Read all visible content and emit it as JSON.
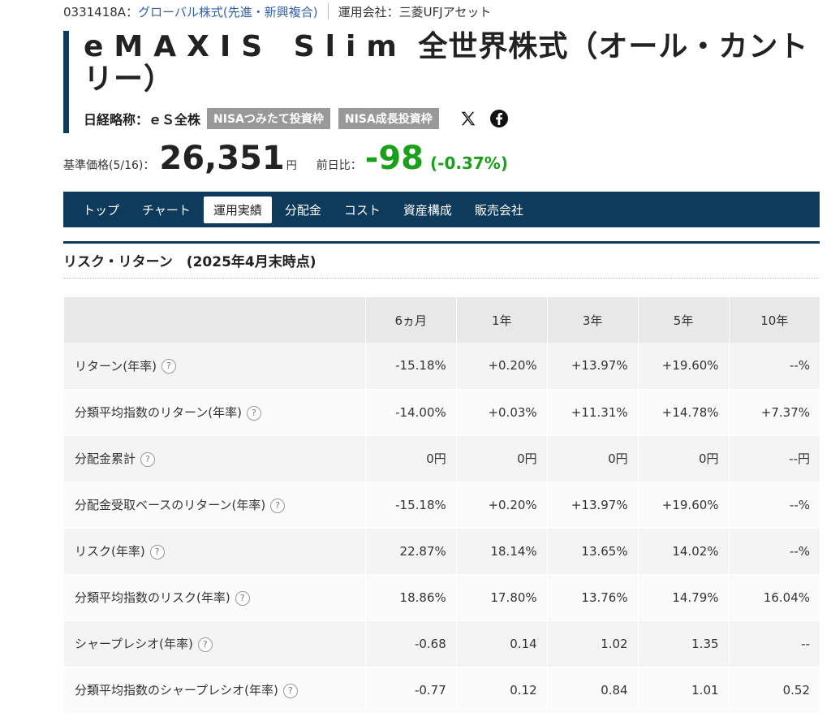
{
  "meta": {
    "fund_code": "0331418A：",
    "category": "グローバル株式(先進・新興複合)",
    "company": "運用会社：三菱UFJアセット"
  },
  "title": {
    "latin": "eMAXIS Slim",
    "rest": " 全世界株式（オール・カントリー）"
  },
  "nickname": {
    "label": "日経略称：ｅＳ全株",
    "badges": [
      "NISAつみたて投資枠",
      "NISA成長投資枠"
    ]
  },
  "social": [
    "x-icon",
    "facebook-icon"
  ],
  "price": {
    "label": "基準価格(5/16)：",
    "value": "26,351",
    "unit": "円",
    "diff_label": "前日比：",
    "diff_value": "-98",
    "diff_pct": "(-0.37%)",
    "diff_color": "#1aa01a"
  },
  "tabs": [
    "トップ",
    "チャート",
    "運用実績",
    "分配金",
    "コスト",
    "資産構成",
    "販売会社"
  ],
  "active_tab": "運用実績",
  "section": {
    "title": "リスク・リターン　(2025年4月末時点)"
  },
  "table": {
    "headers": [
      "6ヵ月",
      "1年",
      "3年",
      "5年",
      "10年"
    ],
    "rows": [
      {
        "label": "リターン(年率)",
        "values": [
          "-15.18%",
          "+0.20%",
          "+13.97%",
          "+19.60%",
          "--%"
        ]
      },
      {
        "label": "分類平均指数のリターン(年率)",
        "values": [
          "-14.00%",
          "+0.03%",
          "+11.31%",
          "+14.78%",
          "+7.37%"
        ]
      },
      {
        "label": "分配金累計",
        "values": [
          "0円",
          "0円",
          "0円",
          "0円",
          "--円"
        ]
      },
      {
        "label": "分配金受取ベースのリターン(年率)",
        "values": [
          "-15.18%",
          "+0.20%",
          "+13.97%",
          "+19.60%",
          "--%"
        ]
      },
      {
        "label": "リスク(年率)",
        "values": [
          "22.87%",
          "18.14%",
          "13.65%",
          "14.02%",
          "--%"
        ]
      },
      {
        "label": "分類平均指数のリスク(年率)",
        "values": [
          "18.86%",
          "17.80%",
          "13.76%",
          "14.79%",
          "16.04%"
        ]
      },
      {
        "label": "シャープレシオ(年率)",
        "values": [
          "-0.68",
          "0.14",
          "1.02",
          "1.35",
          "--"
        ]
      },
      {
        "label": "分類平均指数のシャープレシオ(年率)",
        "values": [
          "-0.77",
          "0.12",
          "0.84",
          "1.01",
          "0.52"
        ]
      }
    ]
  },
  "help_glyph": "?"
}
